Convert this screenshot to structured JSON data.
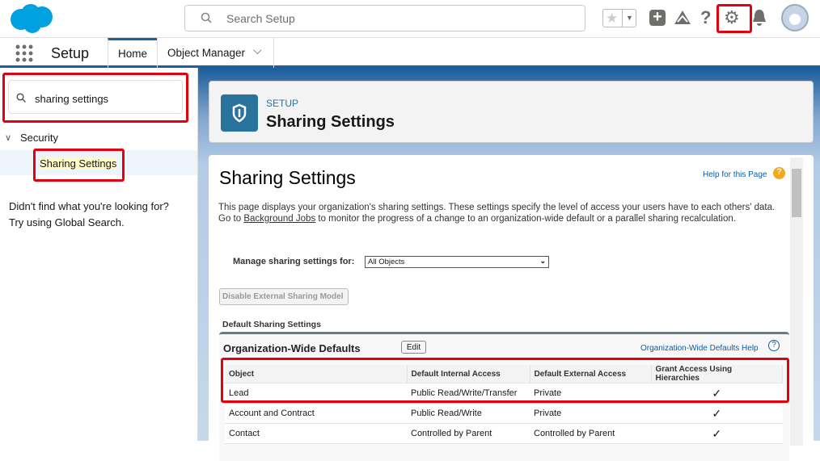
{
  "header": {
    "search_placeholder": "Search Setup"
  },
  "nav": {
    "app_name": "Setup",
    "tabs": [
      {
        "label": "Home",
        "active": true
      },
      {
        "label": "Object Manager"
      }
    ]
  },
  "sidebar": {
    "search_value": "sharing settings",
    "group": "Security",
    "item": "Sharing Settings",
    "hint1": "Didn't find what you're looking for?",
    "hint2": "Try using Global Search."
  },
  "page_header": {
    "eyebrow": "SETUP",
    "title": "Sharing Settings"
  },
  "content": {
    "title": "Sharing Settings",
    "help_link": "Help for this Page",
    "desc_a": "This page displays your organization's sharing settings. These settings specify the level of access your users have to each others' data. Go to ",
    "desc_link": "Background Jobs",
    "desc_b": " to monitor the progress of a change to an organization-wide default or a parallel sharing recalculation.",
    "manage_label": "Manage sharing settings for:",
    "manage_value": "All Objects",
    "disable_button": "Disable External Sharing Model",
    "section_label": "Default Sharing Settings",
    "block_title": "Organization-Wide Defaults",
    "edit_button": "Edit",
    "block_help": "Organization-Wide Defaults Help",
    "columns": [
      "Object",
      "Default Internal Access",
      "Default External Access",
      "Grant Access Using Hierarchies"
    ],
    "rows": [
      [
        "Lead",
        "Public Read/Write/Transfer",
        "Private",
        "✓"
      ],
      [
        "Account and Contract",
        "Public Read/Write",
        "Private",
        "✓"
      ],
      [
        "Contact",
        "Controlled by Parent",
        "Controlled by Parent",
        "✓"
      ]
    ]
  },
  "colors": {
    "brand": "#00a1e0",
    "highlight": "#e3000f",
    "link": "#0b5cab"
  }
}
